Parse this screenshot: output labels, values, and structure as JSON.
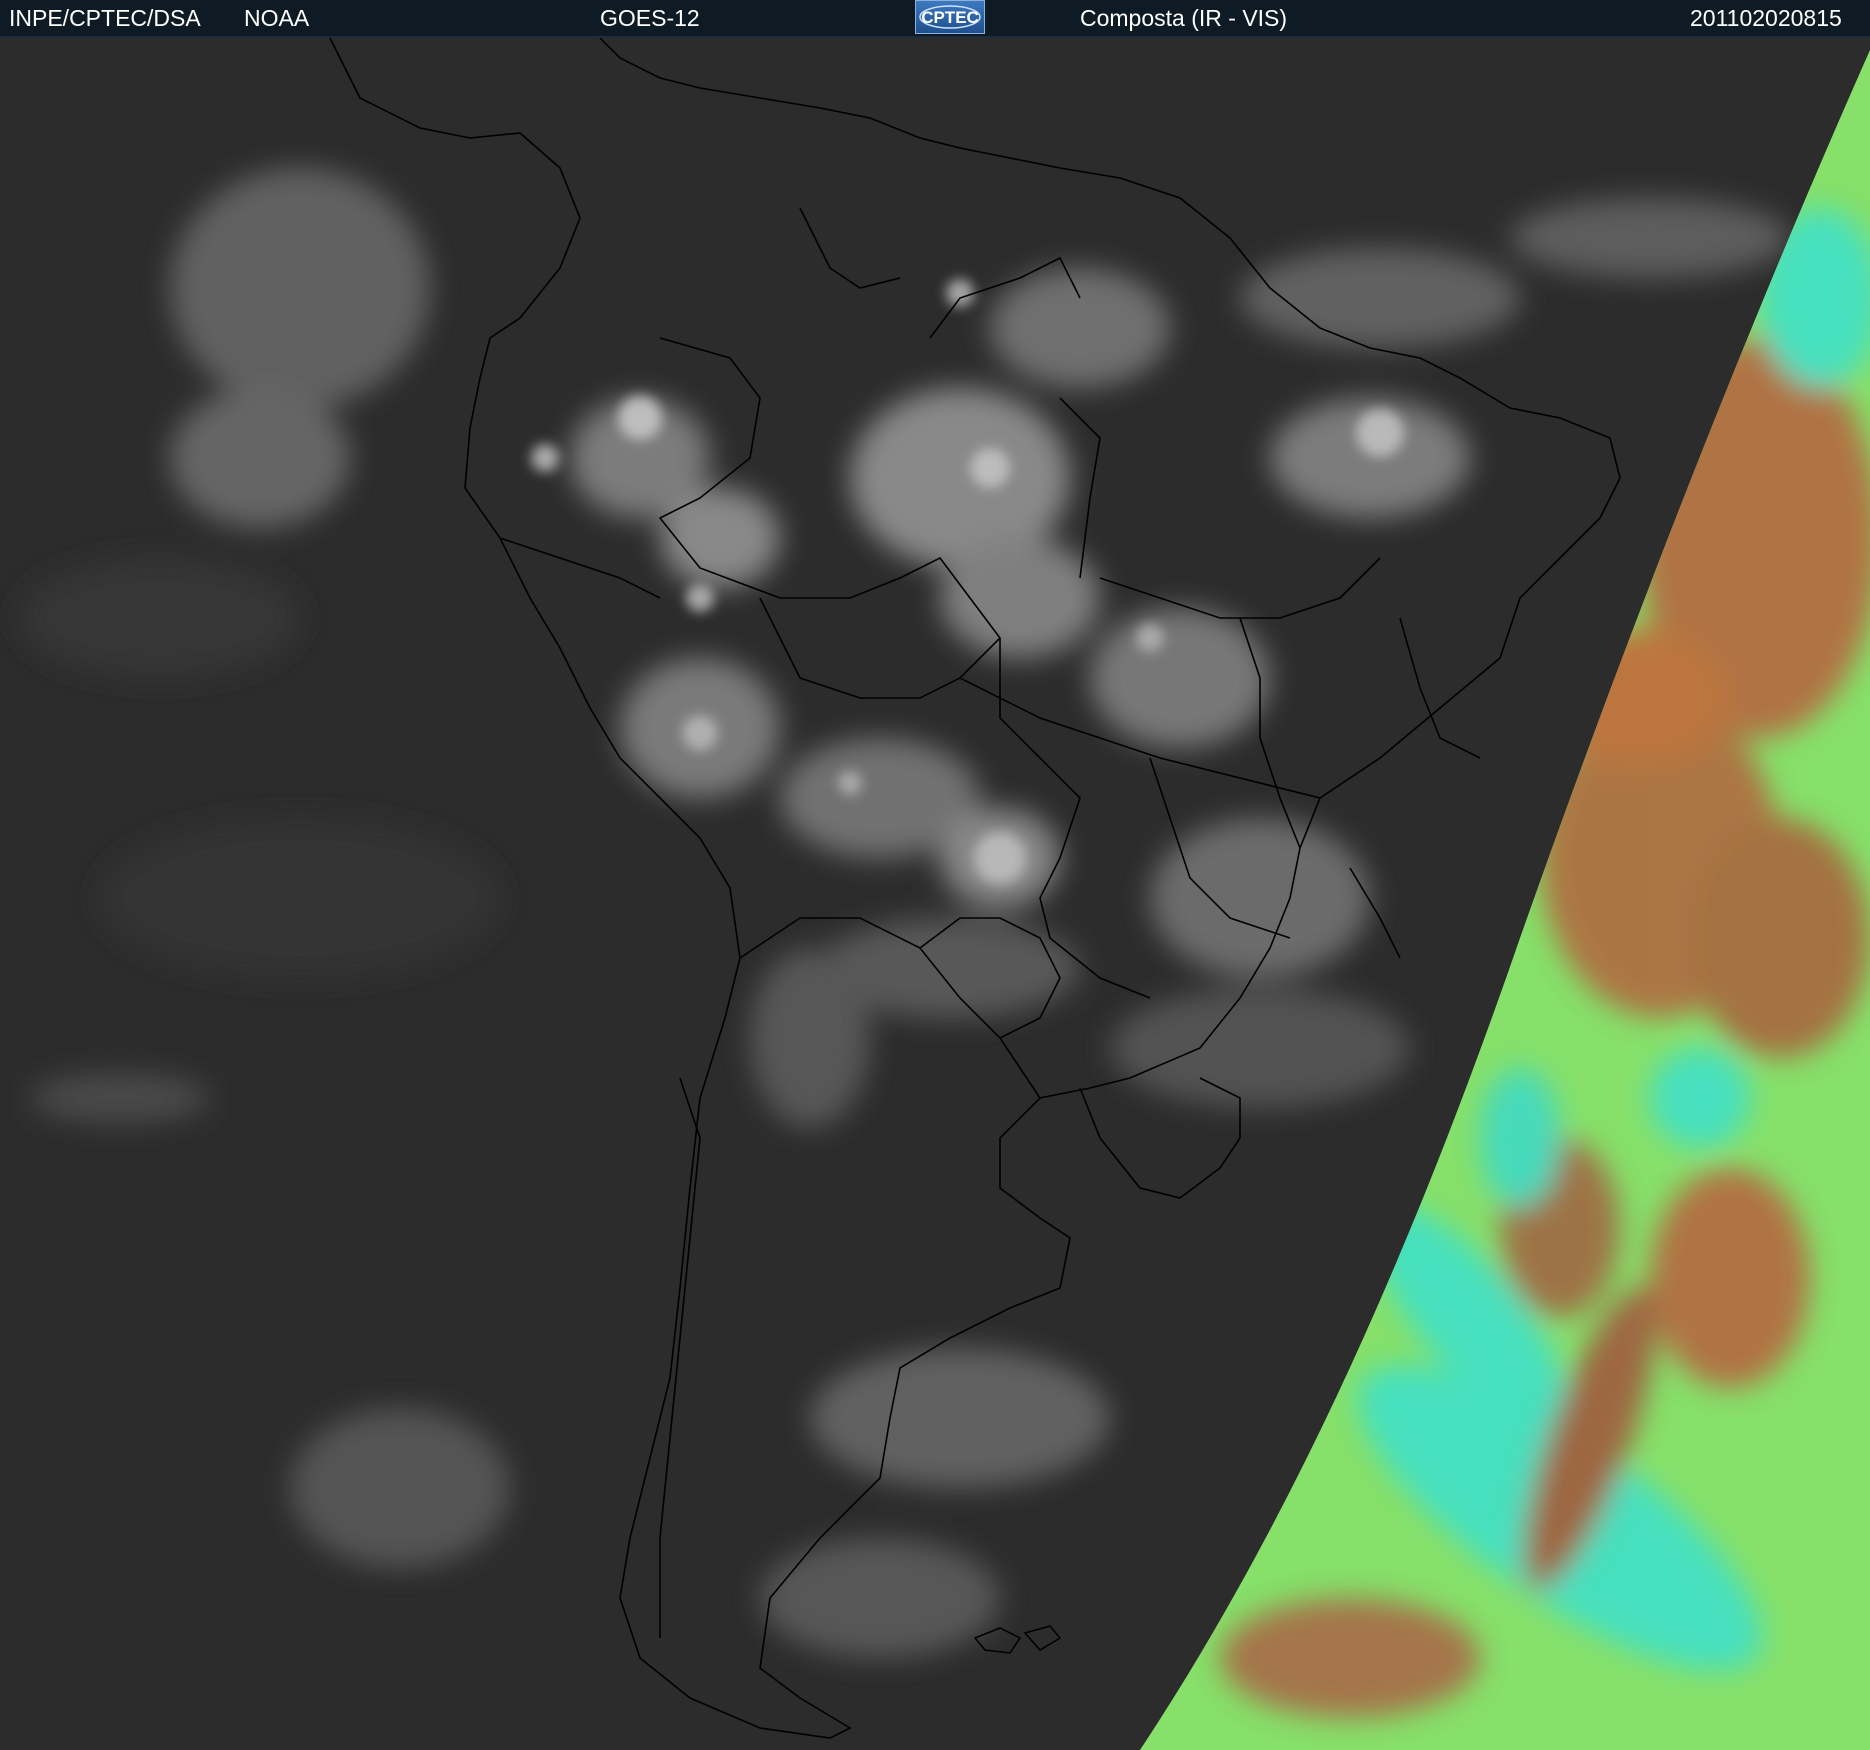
{
  "header": {
    "institution": "INPE/CPTEC/DSA",
    "agency": "NOAA",
    "satellite": "GOES-12",
    "product": "Composta (IR - VIS)",
    "timestamp": "201102020815"
  },
  "logo": {
    "text": "CPTEC",
    "icon": "cptec-logo"
  },
  "map": {
    "region": "South America",
    "ir_side_color": "#2b2b2b",
    "vis_side_colors": [
      "#86e06a",
      "#b5673f",
      "#3fe0c8"
    ],
    "border_color": "#000000"
  }
}
